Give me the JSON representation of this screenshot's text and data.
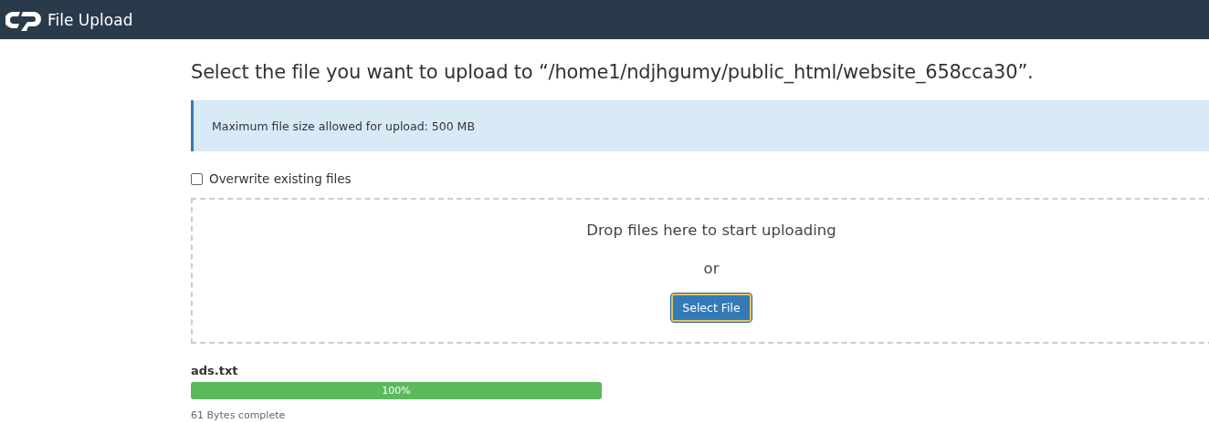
{
  "header": {
    "title": "File Upload"
  },
  "heading": "Select the file you want to upload to “/home1/ndjhgumy/public_html/website_658cca30”.",
  "notice": "Maximum file size allowed for upload: 500 MB",
  "overwrite": {
    "label": "Overwrite existing files",
    "checked": false
  },
  "dropzone": {
    "prompt": "Drop files here to start uploading",
    "or": "or",
    "button": "Select File"
  },
  "uploads": [
    {
      "name": "ads.txt",
      "level": 1,
      "percent": "100%",
      "status": "61 Bytes complete"
    }
  ]
}
